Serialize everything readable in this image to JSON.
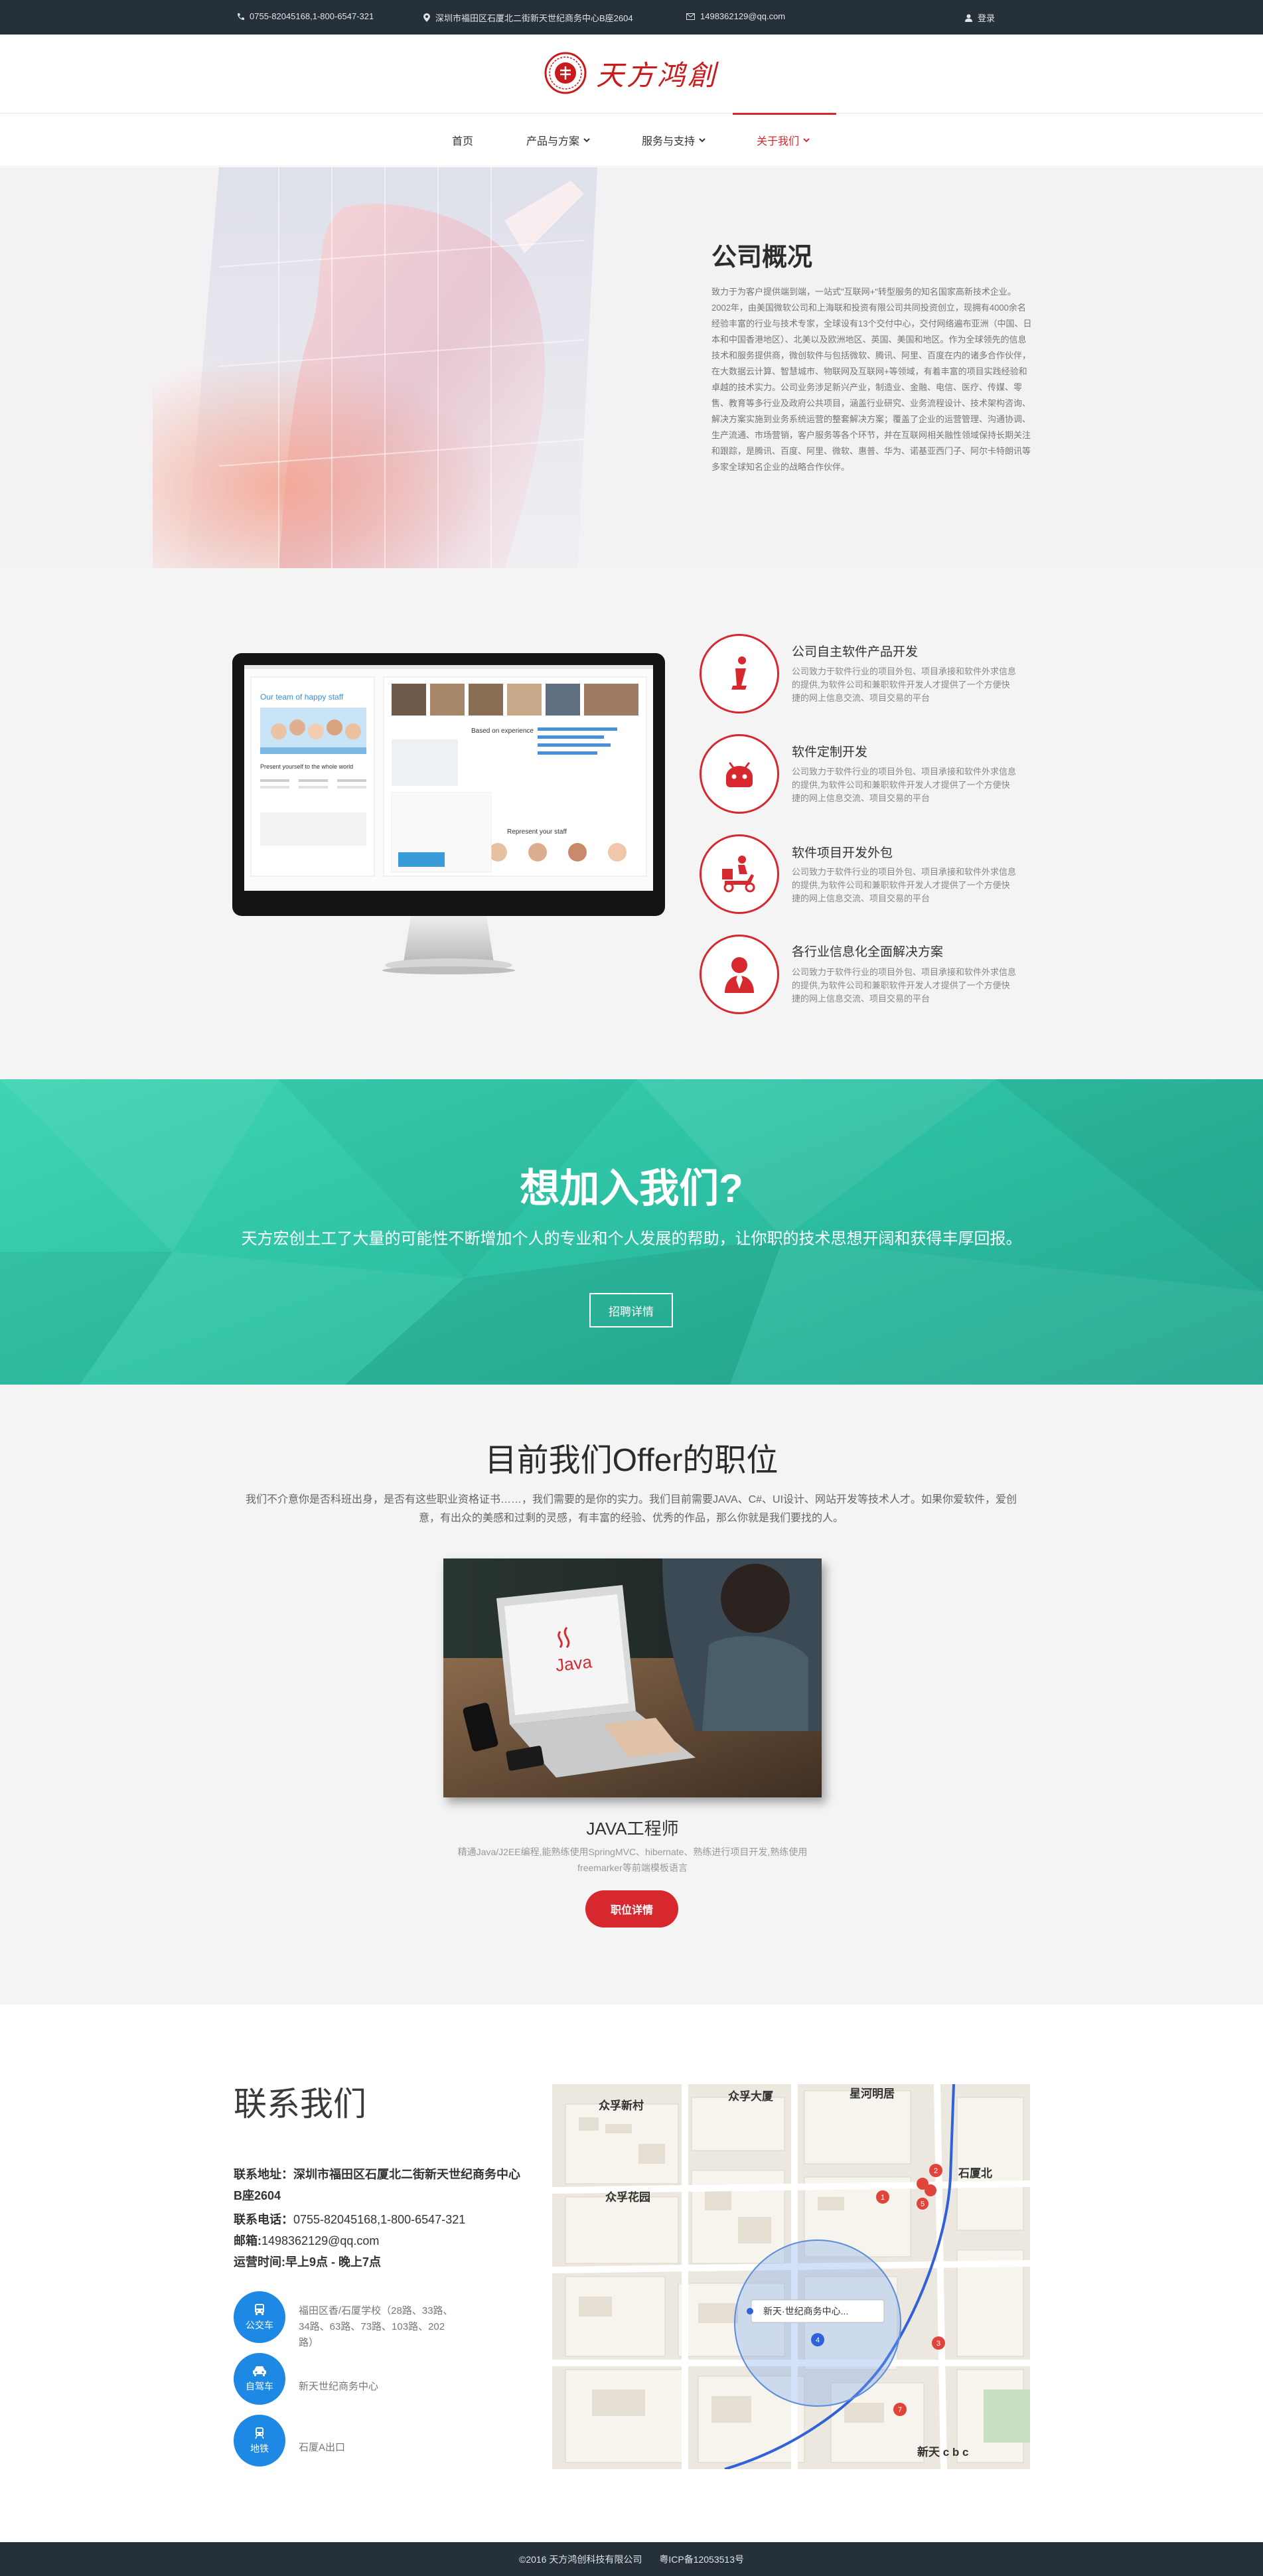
{
  "topbar": {
    "phone": "0755-82045168,1-800-6547-321",
    "address": "深圳市福田区石厦北二街新天世纪商务中心B座2604",
    "email": "1498362129@qq.com",
    "login": "登录"
  },
  "header": {
    "logo_text": "天方鸿創"
  },
  "nav": {
    "items": [
      {
        "label": "首页"
      },
      {
        "label": "产品与方案"
      },
      {
        "label": "服务与支持"
      },
      {
        "label": "关于我们"
      }
    ]
  },
  "hero": {
    "title": "公司概况",
    "text": "致力于为客户提供端到端，一站式\"互联网+\"转型服务的知名国家高新技术企业。2002年，由美国微软公司和上海联和投资有限公司共同投资创立，现拥有4000余名经验丰富的行业与技术专家，全球设有13个交付中心，交付网络遍布亚洲（中国、日本和中国香港地区）、北美以及欧洲地区、英国、美国和地区。作为全球领先的信息技术和服务提供商，微创软件与包括微软、腾讯、阿里、百度在内的诸多合作伙伴，在大数据云计算、智慧城市、物联网及互联网+等领域，有着丰富的项目实践经验和卓越的技术实力。公司业务涉足新兴产业，制造业、金融、电信、医疗、传媒、零售、教育等多行业及政府公共项目，涵盖行业研究、业务流程设计、技术架构咨询、解决方案实施到业务系统运营的整套解决方案；覆盖了企业的运营管理、沟通协调、生产流通、市场营销，客户服务等各个环节，并在互联网相关融性领域保持长期关注和跟踪，是腾讯、百度、阿里、微软、惠普、华为、诺基亚西门子、阿尔卡特朗讯等多家全球知名企业的战略合作伙伴。"
  },
  "services": [
    {
      "icon": "info-icon",
      "title": "公司自主软件产品开发",
      "text": "公司致力于软件行业的项目外包、项目承接和软件外求信息的提供,为软件公司和兼职软件开发人才提供了一个方便快捷的网上信息交流、项目交易的平台"
    },
    {
      "icon": "android-icon",
      "title": "软件定制开发",
      "text": "公司致力于软件行业的项目外包、项目承接和软件外求信息的提供,为软件公司和兼职软件开发人才提供了一个方便快捷的网上信息交流、项目交易的平台"
    },
    {
      "icon": "delivery-icon",
      "title": "软件项目开发外包",
      "text": "公司致力于软件行业的项目外包、项目承接和软件外求信息的提供,为软件公司和兼职软件开发人才提供了一个方便快捷的网上信息交流、项目交易的平台"
    },
    {
      "icon": "businessman-icon",
      "title": "各行业信息化全面解决方案",
      "text": "公司致力于软件行业的项目外包、项目承接和软件外求信息的提供,为软件公司和兼职软件开发人才提供了一个方便快捷的网上信息交流、项目交易的平台"
    }
  ],
  "monitor": {
    "headline": "Our team of happy staff",
    "sub1": "Present yourself to the whole world",
    "sub2": "Based on experience",
    "sub3": "Represent your staff"
  },
  "join": {
    "title": "想加入我们?",
    "text": "天方宏创土工了大量的可能性不断增加个人的专业和个人发展的帮助，让你职的技术思想开阔和获得丰厚回报。",
    "button": "招聘详情"
  },
  "offers": {
    "title": "目前我们Offer的职位",
    "text": "我们不介意你是否科班出身，是否有这些职业资格证书……，我们需要的是你的实力。我们目前需要JAVA、C#、UI设计、网站开发等技术人才。如果你爱软件，爱创意，有出众的美感和过剩的灵感，有丰富的经验、优秀的作品，那么你就是我们要找的人。",
    "job_title": "JAVA工程师",
    "job_text": "精通Java/J2EE编程,能熟练使用SpringMVC、hibernate、熟练进行项目开发,熟练使用freemarker等前端模板语言",
    "job_button": "职位详情",
    "laptop_label": "Java"
  },
  "contact": {
    "title": "联系我们",
    "address_label": "联系地址：",
    "address": "深圳市福田区石厦北二街新天世纪商务中心B座2604",
    "phone_label": "联系电话：",
    "phone": "0755-82045168,1-800-6547-321",
    "email_label": "邮箱:",
    "email": "1498362129@qq.com",
    "hours": "运营时间:早上9点 - 晚上7点",
    "transport": [
      {
        "label": "公交车",
        "text": "福田区香/石厦学校（28路、33路、34路、63路、73路、103路、202路）"
      },
      {
        "label": "自驾车",
        "text": "新天世纪商务中心"
      },
      {
        "label": "地铁",
        "text": "石厦A出口"
      }
    ]
  },
  "map": {
    "labels": [
      "众孚大厦",
      "众孚新村",
      "星河明居",
      "众孚花园",
      "石厦北",
      "新天·世纪商务中心...",
      "新天 c b c"
    ],
    "pins": [
      "1",
      "2",
      "3",
      "4",
      "5",
      "7"
    ]
  },
  "footer": {
    "copyright": "©2016 天方鸿创科技有限公司",
    "icp": "粤ICP备12053513号"
  },
  "colors": {
    "accent": "#d7282f",
    "dark": "#263038",
    "teal": "#2ec2a5",
    "blue": "#1e88e5"
  }
}
